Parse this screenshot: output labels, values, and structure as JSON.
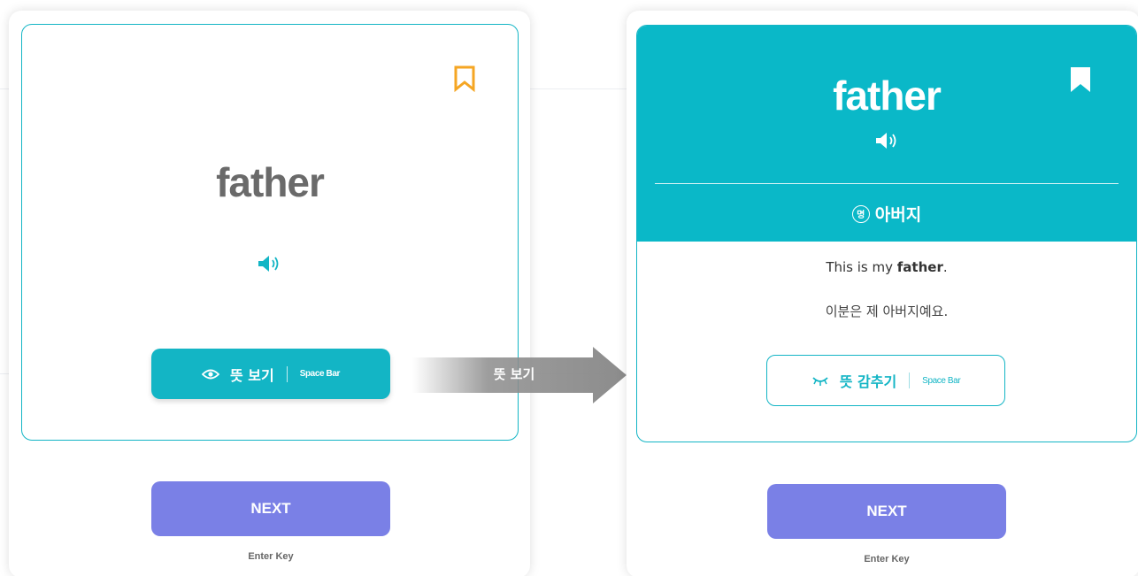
{
  "front_card": {
    "word": "father",
    "show_meaning_label": "뜻 보기",
    "show_meaning_hint": "Space Bar",
    "bookmark_icon": "bookmark-outline-icon",
    "speaker_icon": "speaker-icon"
  },
  "back_card": {
    "word": "father",
    "part_of_speech": "명",
    "meaning": "아버지",
    "example_prefix": "This is my ",
    "example_highlight": "father",
    "example_suffix": ".",
    "example_translation": "이분은 제 아버지예요.",
    "hide_meaning_label": "뜻 감추기",
    "hide_meaning_hint": "Space Bar",
    "bookmark_icon": "bookmark-filled-icon",
    "speaker_icon": "speaker-icon"
  },
  "arrow_label": "뜻 보기",
  "next": {
    "label": "NEXT",
    "hint": "Enter Key"
  },
  "colors": {
    "accent": "#13b5c5",
    "header": "#0ab8c8",
    "next": "#7a80e6",
    "bookmark": "#f5a623",
    "arrow": "#8c8c8c"
  }
}
